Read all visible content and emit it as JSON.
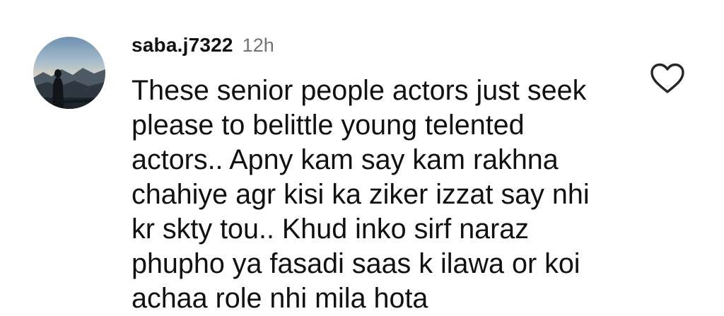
{
  "comment": {
    "username": "saba.j7322",
    "timestamp": "12h",
    "lines": [
      "These senior people actors just seek",
      "please to belittle young telented",
      "actors.. Apny kam say kam rakhna",
      "chahiye agr kisi ka ziker izzat say nhi",
      "kr skty tou.. Khud inko sirf naraz",
      "phupho ya fasadi saas k ilawa or koi",
      "achaa role nhi mila hota"
    ],
    "like_icon": "heart-outline-icon",
    "avatar": "profile-photo"
  },
  "colors": {
    "text": "#111111",
    "secondary_text": "#737373",
    "background": "#ffffff",
    "icon_stroke": "#262626"
  }
}
